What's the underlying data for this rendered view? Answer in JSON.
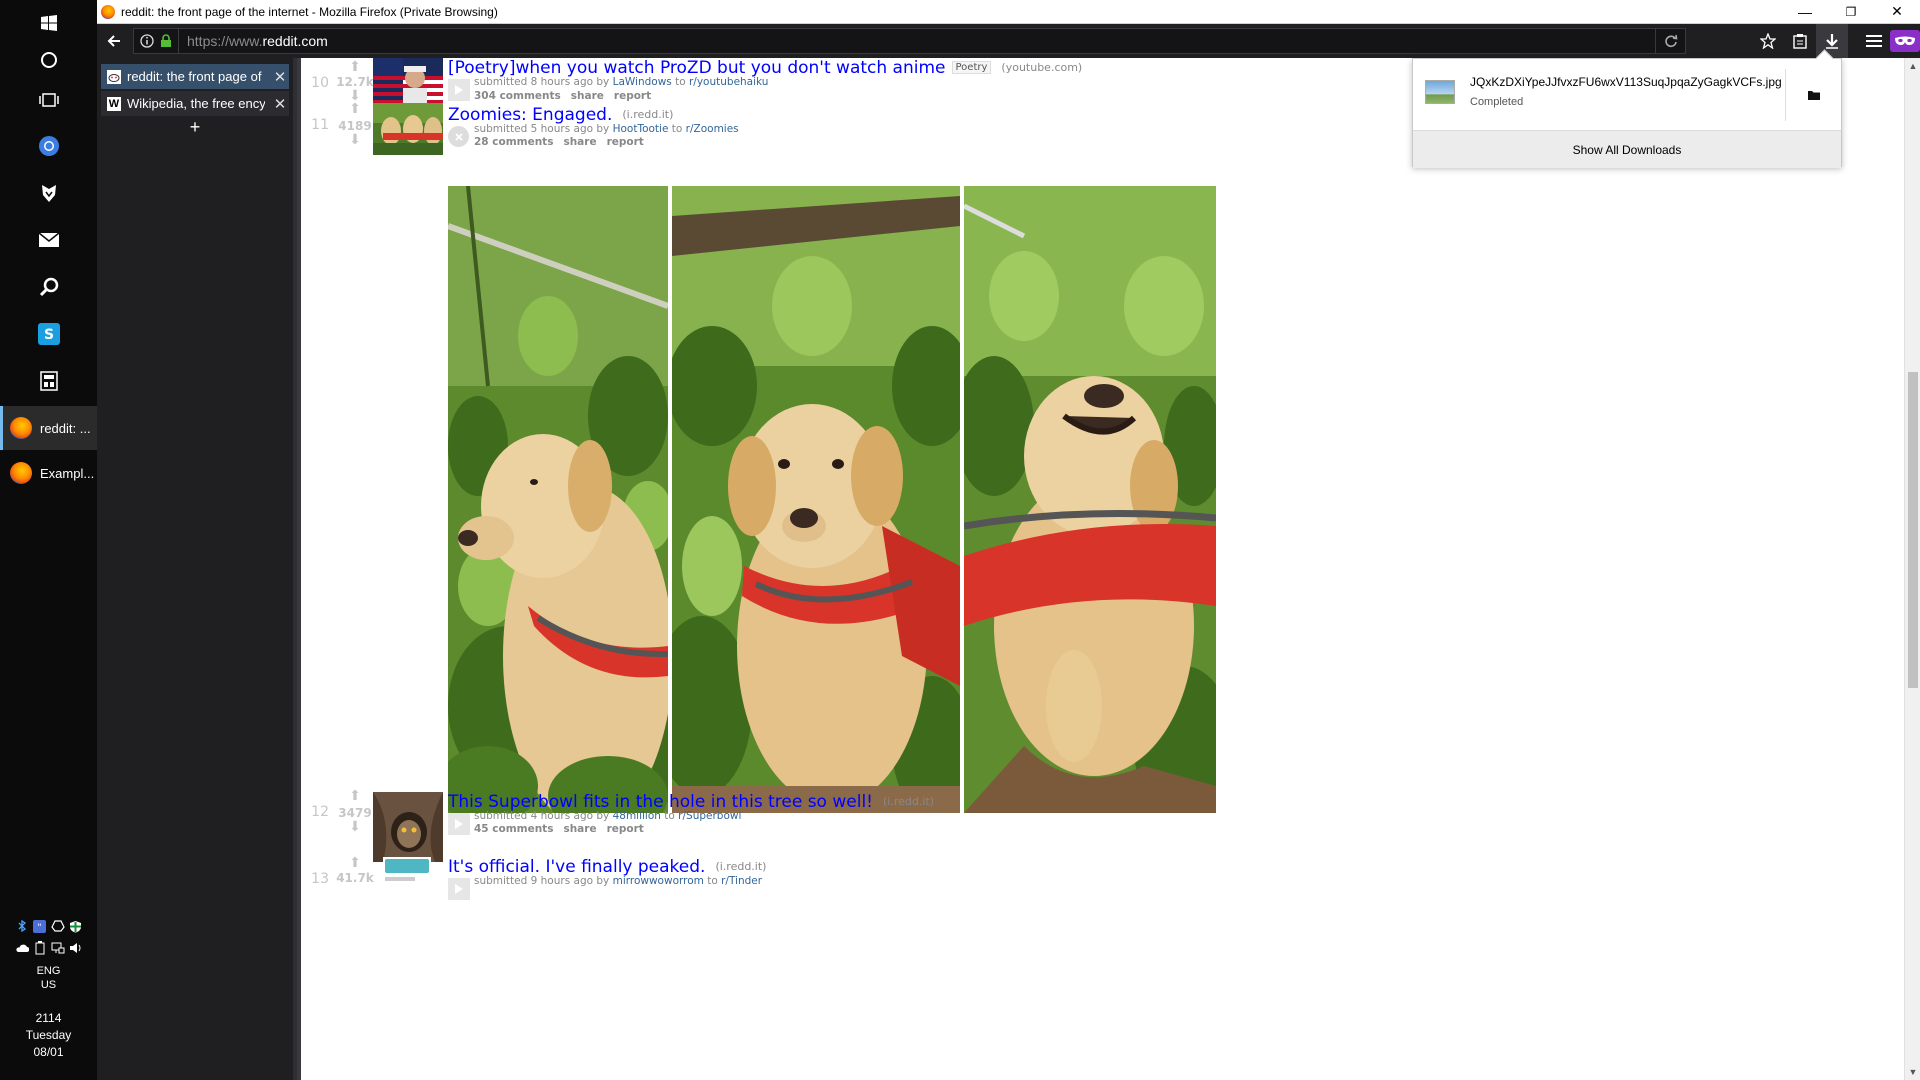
{
  "window": {
    "title": "reddit: the front page of the internet - Mozilla Firefox (Private Browsing)",
    "minimize": "—",
    "restore": "❐",
    "close": "✕"
  },
  "toolbar": {
    "url_prefix": "https://www.",
    "url_host": "reddit.com",
    "private_color": "#8b2fc9"
  },
  "tabs": [
    {
      "label": "reddit: the front page of t",
      "favicon": "reddit-favicon",
      "selected": true
    },
    {
      "label": "Wikipedia, the free encyc",
      "favicon": "W",
      "selected": false
    }
  ],
  "new_tab": "+",
  "taskbar": {
    "apps": [
      {
        "label": "reddit: ...",
        "active": true
      },
      {
        "label": "Exampl...",
        "active": false
      }
    ],
    "language": "ENG",
    "region": "US",
    "time": "2114",
    "day": "Tuesday",
    "date": "08/01"
  },
  "posts": [
    {
      "rank": "10",
      "score": "12.7k",
      "title": "[Poetry]when you watch ProZD but you don't watch anime",
      "flair": "Poetry",
      "domain": "(youtube.com)",
      "submitted": "submitted 8 hours ago by",
      "author": "LaWindows",
      "to": "to",
      "subreddit": "r/youtubehaiku",
      "comments": "304 comments",
      "share": "share",
      "report": "report"
    },
    {
      "rank": "11",
      "score": "4189",
      "title": "Zoomies: Engaged.",
      "domain": "(i.redd.it)",
      "submitted": "submitted 5 hours ago by",
      "author": "HootTootie",
      "to": "to",
      "subreddit": "r/Zoomies",
      "comments": "28 comments",
      "share": "share",
      "report": "report"
    },
    {
      "rank": "12",
      "score": "3479",
      "title": "This Superbowl fits in the hole in this tree so well!",
      "domain": "(i.redd.it)",
      "submitted": "submitted 4 hours ago by",
      "author": "48million",
      "to": "to",
      "subreddit": "r/Superbowl",
      "comments": "45 comments",
      "share": "share",
      "report": "report"
    },
    {
      "rank": "13",
      "score": "41.7k",
      "title": "It's official. I've finally peaked.",
      "domain": "(i.redd.it)",
      "submitted": "submitted 9 hours ago by",
      "author": "mirrowwoworrom",
      "to": "to",
      "subreddit": "r/Tinder"
    }
  ],
  "downloads": {
    "file_name": "JQxKzDXiYpeJJfvxzFU6wxV113SuqJpqaZyGagkVCFs.jpg",
    "status": "Completed",
    "show_all": "Show All Downloads"
  }
}
